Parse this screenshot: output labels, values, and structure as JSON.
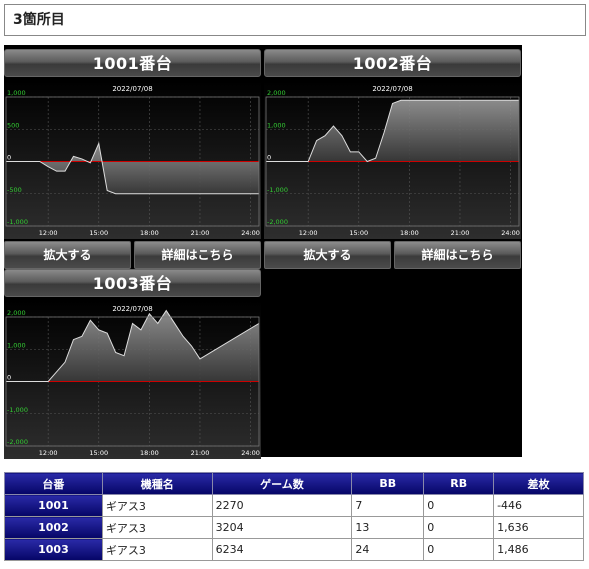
{
  "section_title": "3箇所目",
  "buttons": {
    "enlarge": "拡大する",
    "details": "詳細はこちら"
  },
  "colors": {
    "zero_line": "#cc0000",
    "axis_label": "#33cc33",
    "area_fill": "#555555",
    "line": "#dddddd",
    "negative_value": "#cc0000"
  },
  "charts": [
    {
      "machine": "1001番台",
      "date": "2022/07/08",
      "y_ticks": [
        "1,000",
        "500",
        "0",
        "-500",
        "-1,000"
      ],
      "x_ticks": [
        "12:00",
        "15:00",
        "18:00",
        "21:00",
        "24:00"
      ]
    },
    {
      "machine": "1002番台",
      "date": "2022/07/08",
      "y_ticks": [
        "2,000",
        "1,000",
        "0",
        "-1,000",
        "-2,000"
      ],
      "x_ticks": [
        "12:00",
        "15:00",
        "18:00",
        "21:00",
        "24:00"
      ]
    },
    {
      "machine": "1003番台",
      "date": "2022/07/08",
      "y_ticks": [
        "2,000",
        "1,000",
        "0",
        "-1,000",
        "-2,000"
      ],
      "x_ticks": [
        "12:00",
        "15:00",
        "18:00",
        "21:00",
        "24:00"
      ]
    }
  ],
  "chart_data": [
    {
      "type": "area",
      "title": "1001番台",
      "subtitle": "2022/07/08",
      "xlim": [
        9.5,
        24.5
      ],
      "ylim": [
        -1000,
        1000
      ],
      "x": [
        9.5,
        11.5,
        12.0,
        12.5,
        13.0,
        13.5,
        14.0,
        14.5,
        15.0,
        15.5,
        16.0,
        16.5,
        17.0,
        24.5
      ],
      "y": [
        0,
        0,
        -80,
        -150,
        -150,
        80,
        40,
        -20,
        280,
        -450,
        -500,
        -500,
        -500,
        -500
      ]
    },
    {
      "type": "area",
      "title": "1002番台",
      "subtitle": "2022/07/08",
      "xlim": [
        9.5,
        24.5
      ],
      "ylim": [
        -2000,
        2000
      ],
      "x": [
        9.5,
        12.0,
        12.5,
        13.0,
        13.5,
        14.0,
        14.5,
        15.0,
        15.5,
        16.0,
        16.5,
        17.0,
        17.5,
        18.0,
        24.5
      ],
      "y": [
        0,
        0,
        650,
        800,
        1100,
        800,
        300,
        300,
        0,
        100,
        900,
        1800,
        1900,
        1900,
        1900
      ]
    },
    {
      "type": "area",
      "title": "1003番台",
      "subtitle": "2022/07/08",
      "xlim": [
        9.5,
        24.5
      ],
      "ylim": [
        -2000,
        2000
      ],
      "x": [
        9.5,
        12.0,
        12.5,
        13.0,
        13.5,
        14.0,
        14.5,
        15.0,
        15.5,
        16.0,
        16.5,
        17.0,
        17.5,
        18.0,
        18.5,
        19.0,
        19.5,
        20.0,
        20.5,
        21.0,
        24.5
      ],
      "y": [
        0,
        0,
        300,
        600,
        1300,
        1400,
        1900,
        1600,
        1500,
        900,
        800,
        1800,
        1600,
        2100,
        1800,
        2200,
        1800,
        1400,
        1100,
        700,
        1800,
        1800
      ]
    }
  ],
  "table": {
    "headers": [
      "台番",
      "機種名",
      "ゲーム数",
      "BB",
      "RB",
      "差枚"
    ],
    "rows": [
      {
        "number": "1001",
        "model": "ギアス3",
        "games": "2270",
        "bb": "7",
        "rb": "0",
        "diff": "-446",
        "negative": true
      },
      {
        "number": "1002",
        "model": "ギアス3",
        "games": "3204",
        "bb": "13",
        "rb": "0",
        "diff": "1,636",
        "negative": false
      },
      {
        "number": "1003",
        "model": "ギアス3",
        "games": "6234",
        "bb": "24",
        "rb": "0",
        "diff": "1,486",
        "negative": false
      }
    ]
  }
}
